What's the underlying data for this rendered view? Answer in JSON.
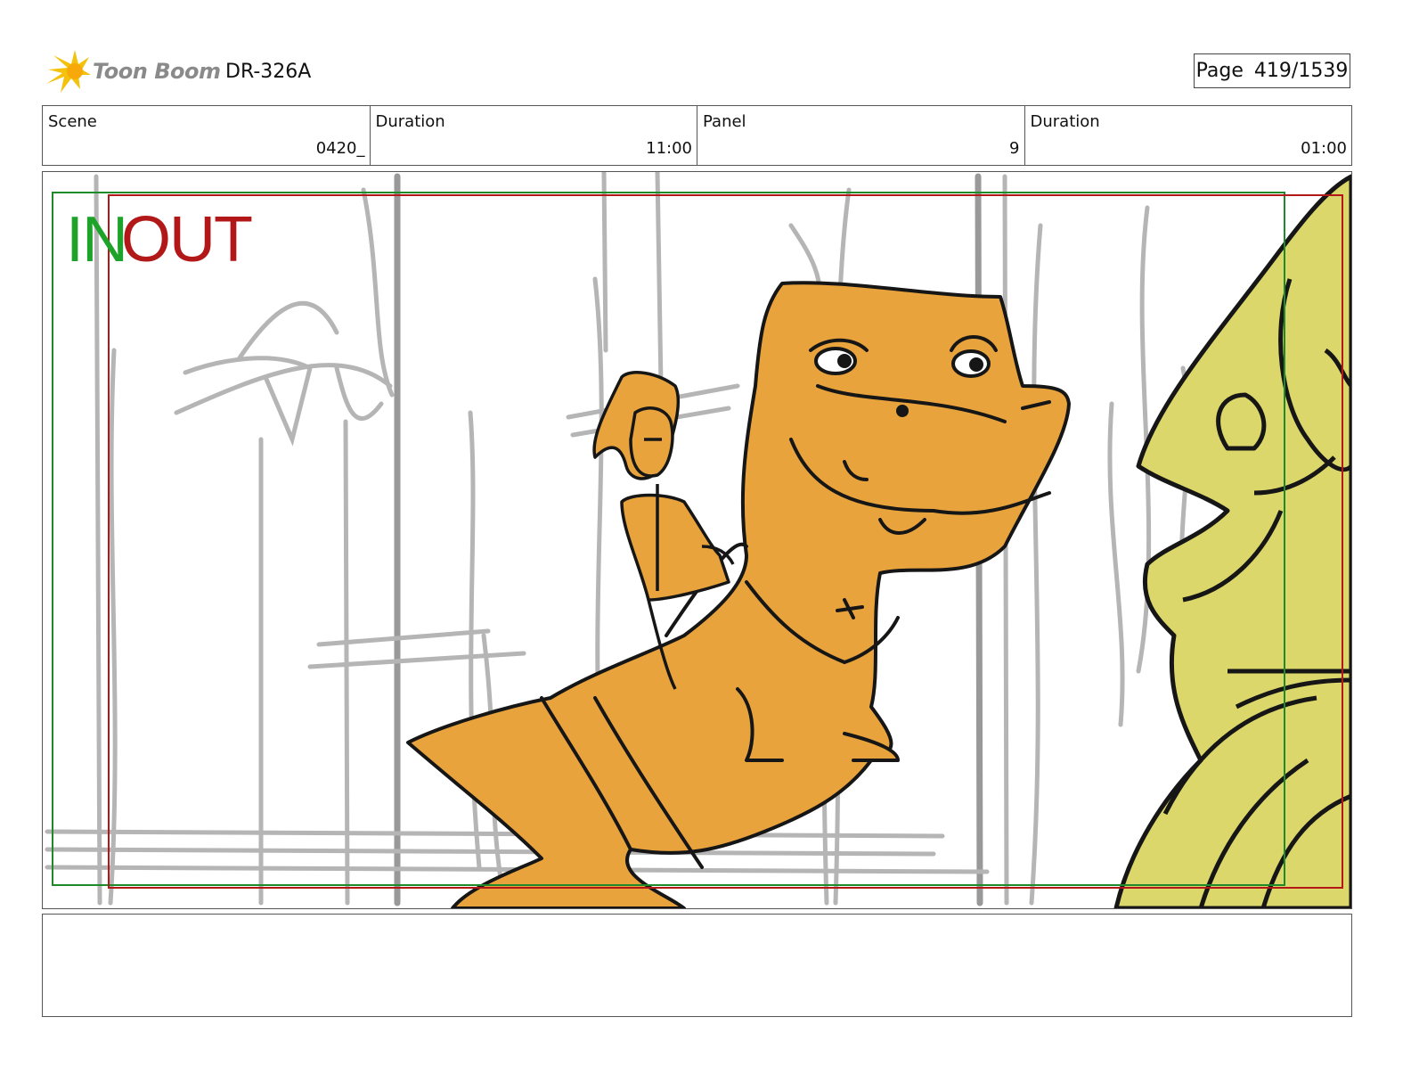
{
  "header": {
    "logo_text": "Toon Boom",
    "doc_id": "DR-326A",
    "page_label": "Page",
    "page_value": "419/1539"
  },
  "info": [
    {
      "label": "Scene",
      "value": "0420_"
    },
    {
      "label": "Duration",
      "value": "11:00"
    },
    {
      "label": "Panel",
      "value": "9"
    },
    {
      "label": "Duration",
      "value": "01:00"
    }
  ],
  "panel": {
    "in_text": "IN",
    "out_text": "OUT",
    "colors": {
      "in": "#1ea32a",
      "out": "#b21818",
      "dino": "#e8a33d",
      "statue": "#dcd76a"
    }
  },
  "notes": {
    "text": ""
  }
}
